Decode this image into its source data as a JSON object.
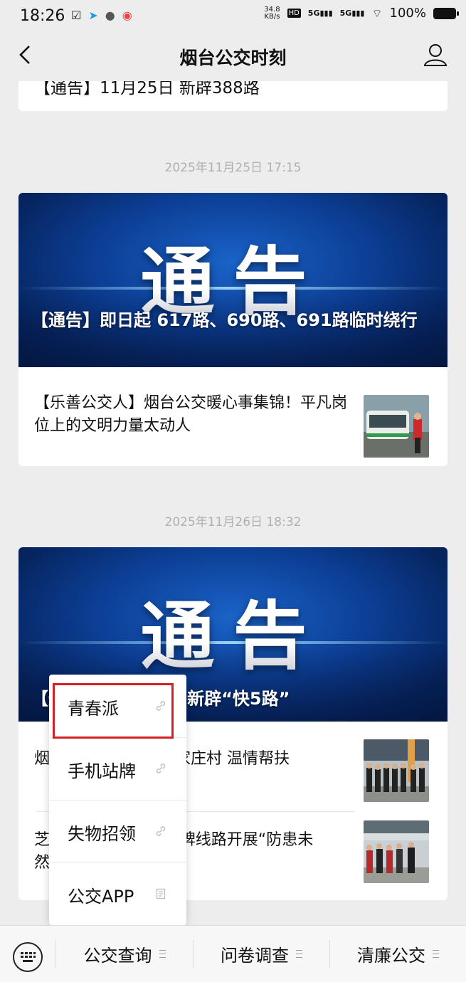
{
  "status": {
    "time": "18:26",
    "speed_value": "34.8",
    "speed_unit": "KB/s",
    "battery": "100%"
  },
  "nav": {
    "title": "烟台公交时刻"
  },
  "feed": {
    "card1": {
      "text": "【通告】11月25日 新辟388路"
    },
    "group2": {
      "timestamp": "2025年11月25日 17:15",
      "banner_big": "通告",
      "banner_caption": "【通告】即日起 617路、690路、691路临时绕行",
      "item": "【乐善公交人】烟台公交暖心事集锦！平凡岗位上的文明力量太动人"
    },
    "group3": {
      "timestamp": "2025年11月26日 18:32",
      "banner_big": "通告",
      "banner_caption": "【通告】11月26日 新辟“快5路”",
      "item1": "烟台公交开展慰问顾家庄村 温情帮扶",
      "item2": "芝罘区16路“文旅”品牌线路开展“防患未然”主题活动"
    }
  },
  "popup": {
    "items": [
      "青春派",
      "手机站牌",
      "失物招领",
      "公交APP"
    ]
  },
  "bottom": {
    "menus": [
      "公交查询",
      "问卷调查",
      "清廉公交"
    ]
  }
}
